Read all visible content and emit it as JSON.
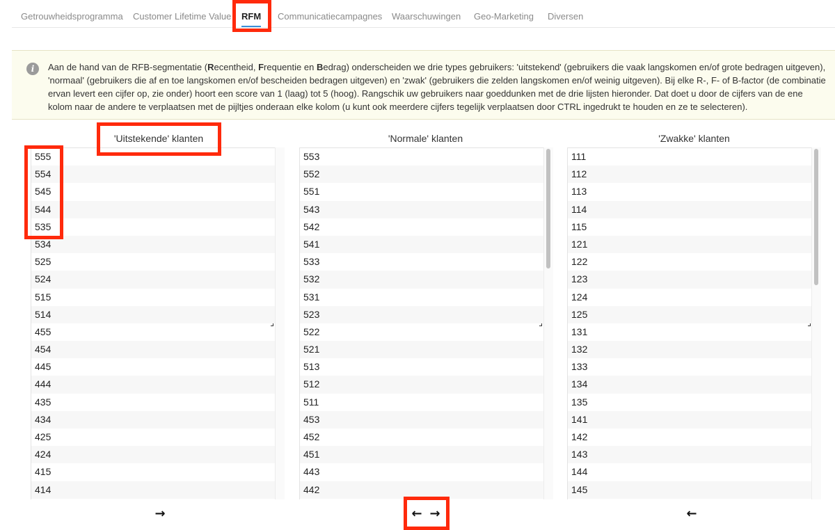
{
  "tabs": [
    {
      "label": "Getrouwheidsprogramma",
      "active": false
    },
    {
      "label": "Customer Lifetime Value",
      "active": false
    },
    {
      "label": "RFM",
      "active": true
    },
    {
      "label": "Communicatiecampagnes",
      "active": false
    },
    {
      "label": "Waarschuwingen",
      "active": false
    },
    {
      "label": "Geo-Marketing",
      "active": false
    },
    {
      "label": "Diversen",
      "active": false
    }
  ],
  "info": {
    "icon": "info-icon",
    "text_before": "Aan de hand van de RFB-segmentatie (",
    "r_bold": "R",
    "r_rest": "ecentheid, ",
    "f_bold": "F",
    "f_rest": "requentie en ",
    "b_bold": "B",
    "text_after": "edrag) onderscheiden we drie types gebruikers: 'uitstekend' (gebruikers die vaak langskomen en/of grote bedragen uitgeven), 'normaal' (gebruikers die af en toe langskomen en/of bescheiden bedragen uitgeven) en 'zwak' (gebruikers die zelden langskomen en/of weinig uitgeven). Bij elke R-, F- of B-factor (de combinatie ervan levert een cijfer op, zie onder) hoort een score van 1 (laag) tot 5 (hoog). Rangschik uw gebruikers naar goeddunken met de drie lijsten hieronder. Dat doet u door de cijfers van de ene kolom naar de andere te verplaatsen met de pijltjes onderaan elke kolom (u kunt ook meerdere cijfers tegelijk verplaatsen door CTRL ingedrukt te houden en ze te selecteren)."
  },
  "columns": [
    {
      "title": "'Uitstekende' klanten",
      "items": [
        "555",
        "554",
        "545",
        "544",
        "535",
        "534",
        "525",
        "524",
        "515",
        "514",
        "455",
        "454",
        "445",
        "444",
        "435",
        "434",
        "425",
        "424",
        "415",
        "414"
      ],
      "arrows": [
        "→"
      ]
    },
    {
      "title": "'Normale' klanten",
      "items": [
        "553",
        "552",
        "551",
        "543",
        "542",
        "541",
        "533",
        "532",
        "531",
        "523",
        "522",
        "521",
        "513",
        "512",
        "511",
        "453",
        "452",
        "451",
        "443",
        "442"
      ],
      "arrows": [
        "←",
        "→"
      ]
    },
    {
      "title": "'Zwakke' klanten",
      "items": [
        "111",
        "112",
        "113",
        "114",
        "115",
        "121",
        "122",
        "123",
        "124",
        "125",
        "131",
        "132",
        "133",
        "134",
        "135",
        "141",
        "142",
        "143",
        "144",
        "145"
      ],
      "arrows": [
        "←"
      ]
    }
  ],
  "colors": {
    "highlight": "#ff2a0c",
    "active_tab_underline": "#3a8fd8",
    "info_background": "#fcfcee"
  }
}
